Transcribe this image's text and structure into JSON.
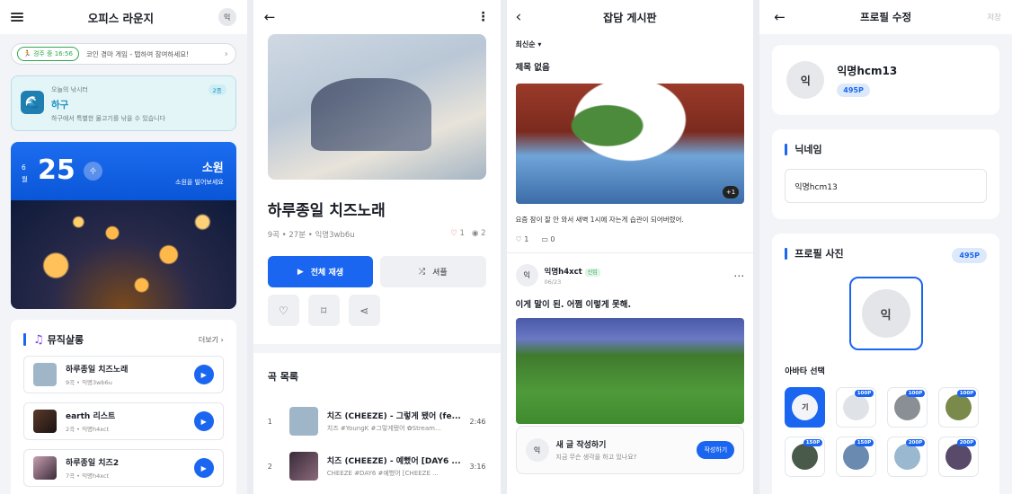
{
  "lounge": {
    "title": "오피스 라운지",
    "avatar": "익",
    "race": {
      "pill": "경주 중 16:56",
      "text": "코인 경마 게임 - 탭하여 참여하세요!"
    },
    "fishing": {
      "label": "오늘의 낚시터",
      "title": "하구",
      "desc": "하구에서 특별한 물고기를 낚을 수 있습니다",
      "badge": "2종"
    },
    "wish": {
      "month_top": "6",
      "month_bottom": "월",
      "day": "25",
      "dow": "수",
      "title": "소원",
      "sub": "소원을 빌어보세요"
    },
    "music": {
      "title": "뮤직살롱",
      "more": "더보기",
      "items": [
        {
          "name": "하루종일 치즈노래",
          "meta": "9곡 • 익명3wb6u"
        },
        {
          "name": "earth 리스트",
          "meta": "2곡 • 익명h4xct"
        },
        {
          "name": "하루종일 치즈2",
          "meta": "7곡 • 익명h4xct"
        }
      ]
    }
  },
  "playlist": {
    "title": "하루종일 치즈노래",
    "info": "9곡 • 27분 • 익명3wb6u",
    "likes": "1",
    "views": "2",
    "play_all": "전체 재생",
    "shuffle": "셔플",
    "tracks_title": "곡 목록",
    "tracks": [
      {
        "no": "1",
        "name": "치즈 (CHEEZE) - 그렇게 됐어 (fe...",
        "tags": "치즈 #YoungK #그렇게됐어 ✿Stream...",
        "dur": "2:46"
      },
      {
        "no": "2",
        "name": "치즈 (CHEEZE) - 예뻤어 [DAY6 ...",
        "tags": "CHEEZE #DAY6 #예뻤어 [CHEEZE ...",
        "dur": "3:16"
      }
    ]
  },
  "board": {
    "title": "잡담 게시판",
    "sort": "최신순",
    "post1": {
      "title": "제목 없음",
      "img_badge": "+1",
      "text": "요즘 잠이 잘 안 와서 새벽 1시에 자는게 습관이 되어버렸어.",
      "likes": "1",
      "comments": "0"
    },
    "post2": {
      "author": "익명h4xct",
      "badge": "신입",
      "date": "06/23",
      "avatar": "익",
      "title": "이게 말이 된. 어쩜 이렇게 못해."
    },
    "compose": {
      "avatar": "익",
      "title": "새 글 작성하기",
      "sub": "지금 무슨 생각을 하고 있나요?",
      "button": "작성하기"
    }
  },
  "profile": {
    "title": "프로필 수정",
    "save": "저장",
    "avatar": "익",
    "name": "익명hcm13",
    "points": "495P",
    "nickname_title": "닉네임",
    "nickname_value": "익명hcm13",
    "photo_title": "프로필 사진",
    "photo_points": "495P",
    "big_avatar": "익",
    "avatar_select": "아바타 선택",
    "options": [
      {
        "label": "기",
        "price": ""
      },
      {
        "label": "",
        "price": "100P"
      },
      {
        "label": "",
        "price": "100P"
      },
      {
        "label": "",
        "price": "100P"
      },
      {
        "label": "",
        "price": "150P"
      },
      {
        "label": "",
        "price": "150P"
      },
      {
        "label": "",
        "price": "200P"
      },
      {
        "label": "",
        "price": "200P"
      }
    ]
  }
}
